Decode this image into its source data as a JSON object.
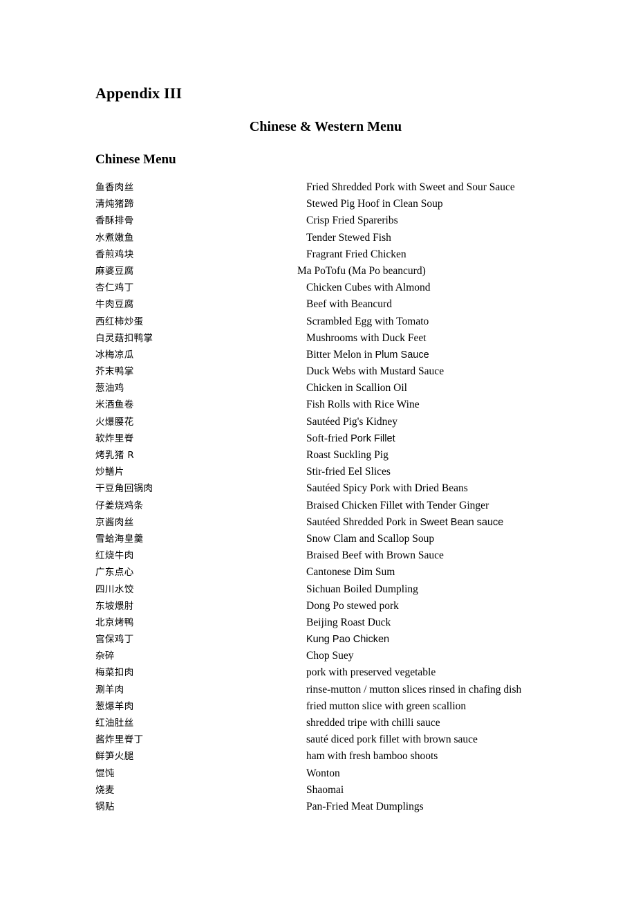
{
  "document": {
    "appendix_title": "Appendix III",
    "subtitle": "Chinese & Western Menu",
    "section_heading": "Chinese Menu"
  },
  "menu": {
    "rows": [
      {
        "cn": "鱼香肉丝",
        "en": "Fried Shredded Pork with Sweet and Sour Sauce"
      },
      {
        "cn": "清炖猪蹄",
        "en": "Stewed Pig Hoof in Clean Soup"
      },
      {
        "cn": "香酥排骨",
        "en": "Crisp Fried Spareribs"
      },
      {
        "cn": "水煮嫩鱼",
        "en": "Tender Stewed Fish"
      },
      {
        "cn": "香煎鸡块",
        "en": "Fragrant Fried Chicken"
      },
      {
        "cn": "麻婆豆腐",
        "en": "Ma PoTofu (Ma Po beancurd)"
      },
      {
        "cn": "杏仁鸡丁",
        "en": "Chicken Cubes with Almond"
      },
      {
        "cn": "牛肉豆腐",
        "en": "Beef with Beancurd"
      },
      {
        "cn": "西红柿炒蛋",
        "en": "Scrambled Egg with Tomato"
      },
      {
        "cn": "白灵菇扣鸭掌",
        "en": "Mushrooms with Duck Feet"
      },
      {
        "cn": "冰梅凉瓜",
        "en_serif": "Bitter Melon in ",
        "en_sans": "Plum Sauce"
      },
      {
        "cn": "芥末鸭掌",
        "en": "Duck Webs with Mustard Sauce"
      },
      {
        "cn": "葱油鸡",
        "en": "Chicken in Scallion Oil"
      },
      {
        "cn": "米酒鱼卷",
        "en": "Fish Rolls with Rice Wine"
      },
      {
        "cn": "火爆腰花",
        "en": "Sautéed Pig's Kidney"
      },
      {
        "cn": "软炸里脊",
        "en_serif": "Soft-fried ",
        "en_sans": "Pork Fillet"
      },
      {
        "cn": "烤乳猪 R",
        "en": "Roast Suckling Pig"
      },
      {
        "cn": "炒鳝片",
        "en": "Stir-fried Eel Slices"
      },
      {
        "cn": "干豆角回锅肉",
        "en": "Sautéed Spicy Pork with Dried Beans"
      },
      {
        "cn": "仔姜烧鸡条",
        "en": "Braised Chicken Fillet with Tender Ginger"
      },
      {
        "cn": "京酱肉丝",
        "en_serif": "Sautéed Shredded Pork in ",
        "en_sans": "Sweet Bean sauce"
      },
      {
        "cn": "雪蛤海皇羹",
        "en": "Snow Clam and Scallop Soup"
      },
      {
        "cn": "红烧牛肉",
        "en": "Braised Beef with Brown Sauce"
      },
      {
        "cn": "广东点心",
        "en": "Cantonese Dim Sum"
      },
      {
        "cn": "四川水饺",
        "en": "Sichuan Boiled Dumpling"
      },
      {
        "cn": "东坡煨肘",
        "en": "Dong Po stewed pork"
      },
      {
        "cn": "北京烤鸭",
        "en": "Beijing Roast Duck"
      },
      {
        "cn": "宫保鸡丁",
        "en_serif": "",
        "en_sans": "Kung Pao Chicken"
      },
      {
        "cn": "杂碎",
        "en": "Chop Suey"
      },
      {
        "cn": "梅菜扣肉",
        "en": "pork with preserved vegetable"
      },
      {
        "cn": "涮羊肉",
        "en": "rinse-mutton / mutton slices rinsed in chafing dish"
      },
      {
        "cn": "葱爆羊肉",
        "en": "fried mutton slice with green scallion"
      },
      {
        "cn": "红油肚丝",
        "en": "shredded tripe with chilli sauce"
      },
      {
        "cn": "酱炸里脊丁",
        "en": "sauté diced pork fillet with brown sauce"
      },
      {
        "cn": "鲜笋火腿",
        "en": "ham with fresh bamboo shoots"
      },
      {
        "cn": "馄饨",
        "en": "Wonton"
      },
      {
        "cn": "烧麦",
        "en": "Shaomai"
      },
      {
        "cn": "锅贴",
        "en": "Pan-Fried Meat Dumplings"
      }
    ]
  }
}
